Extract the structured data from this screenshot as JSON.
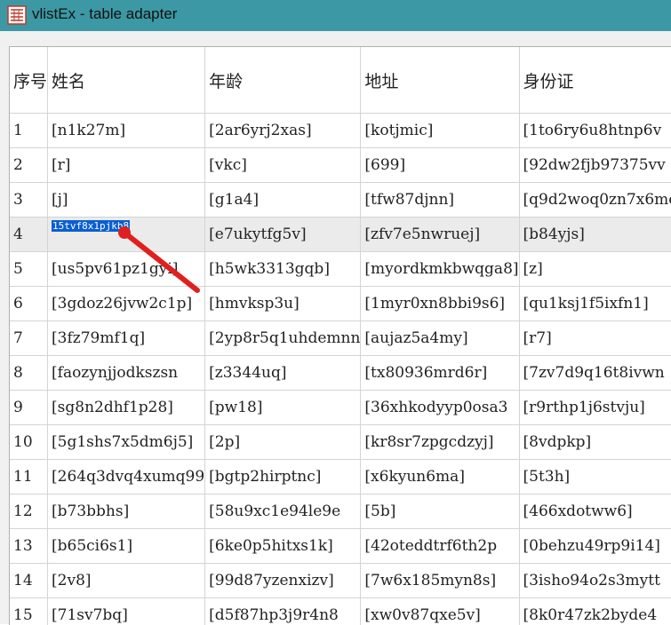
{
  "window": {
    "title": "vlistEx - table adapter",
    "accent": "#3c98a4"
  },
  "table": {
    "columns": [
      "序号",
      "姓名",
      "年龄",
      "地址",
      "身份证"
    ],
    "rows": [
      [
        "1",
        "[n1k27m]",
        "[2ar6yrj2xas]",
        "[kotjmic]",
        "[1to6ry6u8htnp6v"
      ],
      [
        "2",
        "[r]",
        "[vkc]",
        "[699]",
        "[92dw2fjb97375vv"
      ],
      [
        "3",
        "[j]",
        "[g1a4]",
        "[tfw87djnn]",
        "[q9d2woq0zn7x6mc"
      ],
      [
        "4",
        "",
        "[e7ukytfg5v]",
        "[zfv7e5nwruej]",
        "[b84yjs]"
      ],
      [
        "5",
        "[us5pv61pz1gyi]",
        "[h5wk3313gqb]",
        "[myordkmkbwqga8]",
        "[z]"
      ],
      [
        "6",
        "[3gdoz26jvw2c1p]",
        "[hmvksp3u]",
        "[1myr0xn8bbi9s6]",
        "[qu1ksj1f5ixfn1]"
      ],
      [
        "7",
        "[3fz79mf1q]",
        "[2yp8r5q1uhdemnn",
        "[aujaz5a4my]",
        "[r7]"
      ],
      [
        "8",
        "[faozynjjodkszsn",
        "[z3344uq]",
        "[tx80936mrd6r]",
        "[7zv7d9q16t8ivwn"
      ],
      [
        "9",
        "[sg8n2dhf1p28]",
        "[pw18]",
        "[36xhkodyyp0osa3",
        "[r9rthp1j6stvju]"
      ],
      [
        "10",
        "[5g1shs7x5dm6j5]",
        "[2p]",
        "[kr8sr7zpgcdzyj]",
        "[8vdpkp]"
      ],
      [
        "11",
        "[264q3dvq4xumq99",
        "[bgtp2hirptnc]",
        "[x6kyun6ma]",
        "[5t3h]"
      ],
      [
        "12",
        "[b73bbhs]",
        "[58u9xc1e94le9e",
        "[5b]",
        "[466xdotww6]"
      ],
      [
        "13",
        "[b65ci6s1]",
        "[6ke0p5hitxs1k]",
        "[42oteddtrf6th2p",
        "[0behzu49rp9i14]"
      ],
      [
        "14",
        "[2v8]",
        "[99d87yzenxizv]",
        "[7w6x185myn8s]",
        "[3isho94o2s3mytt"
      ],
      [
        "15",
        "[71sv7bq]",
        "[d5f87hp3j9r4n8",
        "[xw0v87qxe5v]",
        "[8k0r47zk2byde4"
      ]
    ],
    "editor": {
      "value": "15tvf8x1pjkb8",
      "row": 3,
      "col": 1
    }
  }
}
